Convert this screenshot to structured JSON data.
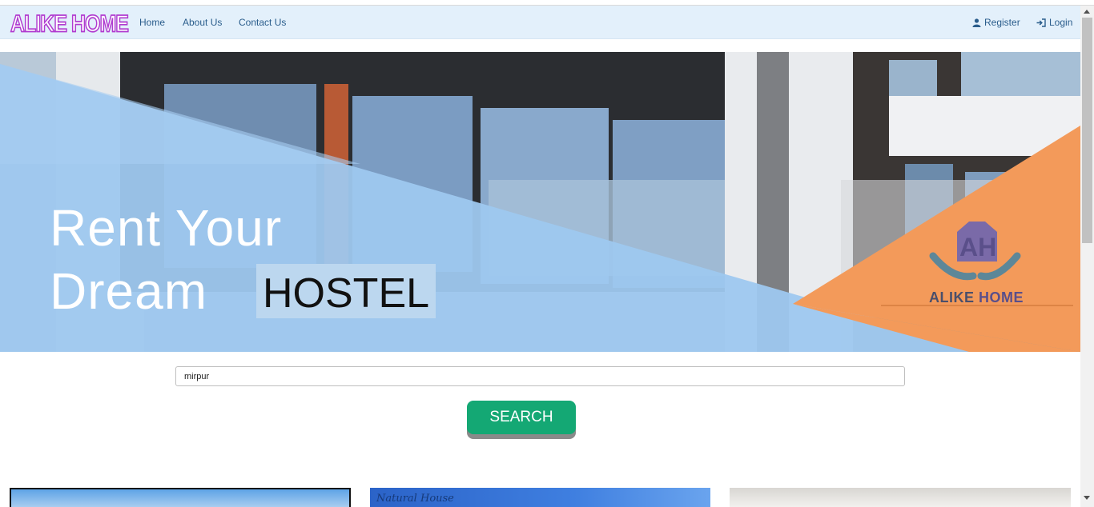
{
  "brand": "ALIKE HOME",
  "nav": {
    "home": "Home",
    "about": "About Us",
    "contact": "Contact Us",
    "register": "Register",
    "login": "Login"
  },
  "hero": {
    "line1": "Rent Your",
    "line2": "Dream",
    "highlight": "HOSTEL",
    "logo_text_a": "ALIKE",
    "logo_text_b": "HOME"
  },
  "search": {
    "value": "mirpur",
    "button": "SEARCH"
  },
  "cards": {
    "card2_caption": "Natural House"
  },
  "colors": {
    "navbar": "#e3f0fb",
    "link": "#2a5d8c",
    "search_button": "#14a874",
    "hero_blue": "#9ec8ef",
    "hero_orange": "#f39a5a"
  },
  "icons": {
    "register": "user-icon",
    "login": "login-icon"
  }
}
